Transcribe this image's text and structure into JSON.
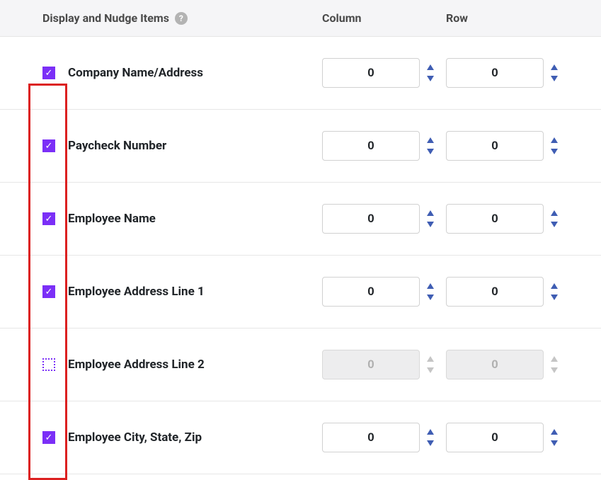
{
  "header": {
    "title": "Display and Nudge Items",
    "help_icon_label": "?",
    "column_label": "Column",
    "row_label": "Row"
  },
  "rows": [
    {
      "label": "Company Name/Address",
      "checked": true,
      "column_value": "0",
      "row_value": "0",
      "enabled": true
    },
    {
      "label": "Paycheck Number",
      "checked": true,
      "column_value": "0",
      "row_value": "0",
      "enabled": true
    },
    {
      "label": "Employee Name",
      "checked": true,
      "column_value": "0",
      "row_value": "0",
      "enabled": true
    },
    {
      "label": "Employee Address Line 1",
      "checked": true,
      "column_value": "0",
      "row_value": "0",
      "enabled": true
    },
    {
      "label": "Employee Address Line 2",
      "checked": false,
      "column_value": "0",
      "row_value": "0",
      "enabled": false
    },
    {
      "label": "Employee City, State, Zip",
      "checked": true,
      "column_value": "0",
      "row_value": "0",
      "enabled": true
    }
  ]
}
